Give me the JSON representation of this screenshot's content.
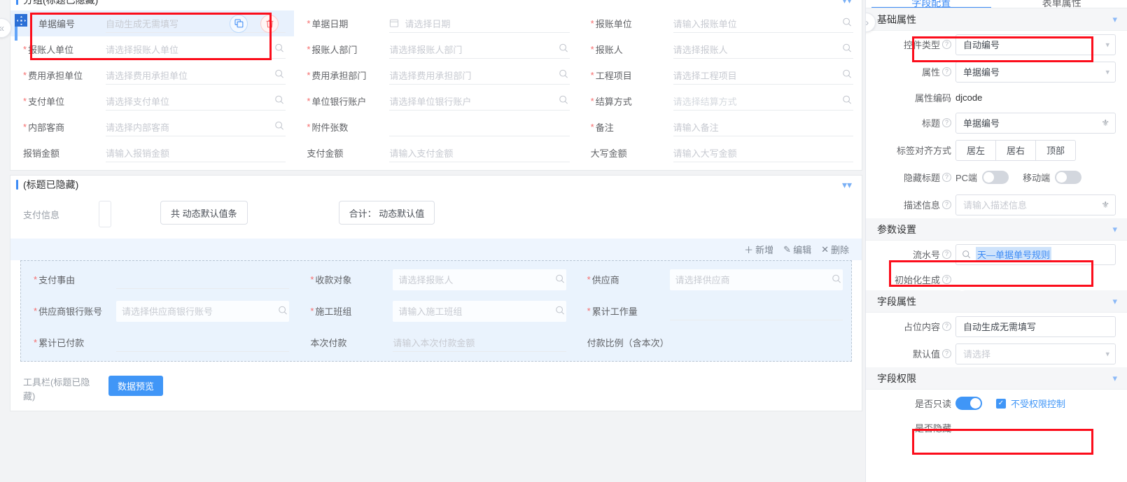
{
  "canvas": {
    "group1": {
      "title": "分组(标题已隐藏)",
      "fields": [
        {
          "label": "单据编号",
          "required": false,
          "placeholder": "自动生成无需填写",
          "icon": "",
          "selected": true
        },
        {
          "label": "单据日期",
          "required": true,
          "placeholder": "请选择日期",
          "icon": "calendar-icon"
        },
        {
          "label": "报账单位",
          "required": true,
          "placeholder": "请输入报账单位",
          "icon": "search-icon"
        },
        {
          "label": "报账人单位",
          "required": true,
          "placeholder": "请选择报账人单位",
          "icon": "search-icon"
        },
        {
          "label": "报账人部门",
          "required": true,
          "placeholder": "请选择报账人部门",
          "icon": "search-icon"
        },
        {
          "label": "报账人",
          "required": true,
          "placeholder": "请选择报账人",
          "icon": "search-icon"
        },
        {
          "label": "费用承担单位",
          "required": true,
          "placeholder": "请选择费用承担单位",
          "icon": "search-icon"
        },
        {
          "label": "费用承担部门",
          "required": true,
          "placeholder": "请选择费用承担部门",
          "icon": "search-icon"
        },
        {
          "label": "工程项目",
          "required": true,
          "placeholder": "请选择工程项目",
          "icon": "search-icon"
        },
        {
          "label": "支付单位",
          "required": true,
          "placeholder": "请选择支付单位",
          "icon": "search-icon"
        },
        {
          "label": "单位银行账户",
          "required": true,
          "placeholder": "请选择单位银行账户",
          "icon": "search-icon"
        },
        {
          "label": "结算方式",
          "required": true,
          "placeholder": "请选择结算方式",
          "icon": "search-icon"
        },
        {
          "label": "内部客商",
          "required": true,
          "placeholder": "请选择内部客商",
          "icon": "search-icon"
        },
        {
          "label": "附件张数",
          "required": true,
          "placeholder": "",
          "icon": ""
        },
        {
          "label": "备注",
          "required": true,
          "placeholder": "请输入备注",
          "icon": ""
        },
        {
          "label": "报销金额",
          "required": false,
          "placeholder": "请输入报销金额",
          "icon": ""
        },
        {
          "label": "支付金额",
          "required": false,
          "placeholder": "请输入支付金额",
          "icon": ""
        },
        {
          "label": "大写金额",
          "required": false,
          "placeholder": "请输入大写金额",
          "icon": ""
        }
      ],
      "row_actions": {
        "copy": "copy-icon",
        "delete": "delete-icon"
      }
    },
    "group2": {
      "title": "(标题已隐藏)",
      "pay_label": "支付信息",
      "count_pill": "共 动态默认值条",
      "total_pill": "合计： 动态默认值",
      "toolbar": [
        {
          "label": "新增",
          "icon": "plus-icon"
        },
        {
          "label": "编辑",
          "icon": "pencil-icon"
        },
        {
          "label": "删除",
          "icon": "close-icon"
        }
      ],
      "detail_fields": [
        {
          "label": "支付事由",
          "required": true,
          "placeholder": "",
          "icon": "",
          "boxed": false
        },
        {
          "label": "收款对象",
          "required": true,
          "placeholder": "请选择报账人",
          "icon": "search-icon",
          "boxed": true
        },
        {
          "label": "供应商",
          "required": true,
          "placeholder": "请选择供应商",
          "icon": "search-icon",
          "boxed": true
        },
        {
          "label": "供应商银行账号",
          "required": true,
          "placeholder": "请选择供应商银行账号",
          "icon": "search-icon",
          "boxed": true
        },
        {
          "label": "施工班组",
          "required": true,
          "placeholder": "请输入施工班组",
          "icon": "search-icon",
          "boxed": true
        },
        {
          "label": "累计工作量",
          "required": true,
          "placeholder": "",
          "icon": "",
          "boxed": false
        },
        {
          "label": "累计已付款",
          "required": true,
          "placeholder": "",
          "icon": "",
          "boxed": false
        },
        {
          "label": "本次付款",
          "required": false,
          "placeholder": "请输入本次付款金额",
          "icon": "",
          "boxed": false
        },
        {
          "label": "付款比例（含本次）",
          "required": false,
          "placeholder": "",
          "icon": "",
          "boxed": false
        }
      ],
      "bottom_toolbar_label": "工具栏(标题已隐藏)",
      "preview_button": "数据预览"
    }
  },
  "rightPanel": {
    "tabs": [
      {
        "label": "字段配置",
        "active": true
      },
      {
        "label": "表单属性",
        "active": false
      }
    ],
    "sections": [
      {
        "title": "基础属性",
        "rows": [
          {
            "type": "select",
            "label": "控件类型",
            "help": true,
            "value": "自动编号",
            "highlighted": true
          },
          {
            "type": "select",
            "label": "属性",
            "help": true,
            "value": "单据编号"
          },
          {
            "type": "text",
            "label": "属性编码",
            "help": false,
            "value": "djcode"
          },
          {
            "type": "select-globe",
            "label": "标题",
            "help": true,
            "value": "单据编号"
          },
          {
            "type": "segmented",
            "label": "标签对齐方式",
            "help": false,
            "options": [
              "居左",
              "居右",
              "顶部"
            ]
          },
          {
            "type": "dual-switch",
            "label": "隐藏标题",
            "help": true,
            "items": [
              {
                "name": "PC端",
                "on": false
              },
              {
                "name": "移动端",
                "on": false
              }
            ]
          },
          {
            "type": "select-globe",
            "label": "描述信息",
            "help": true,
            "value": "请输入描述信息",
            "placeholder": true
          }
        ]
      },
      {
        "title": "参数设置",
        "rows": [
          {
            "type": "search",
            "label": "流水号",
            "help": true,
            "value": "天—单据单号规则",
            "icon": "search-icon",
            "highlighted": true
          },
          {
            "type": "switch",
            "label": "初始化生成",
            "help": true,
            "on": false
          }
        ]
      },
      {
        "title": "字段属性",
        "rows": [
          {
            "type": "select-plain",
            "label": "占位内容",
            "help": true,
            "value": "自动生成无需填写"
          },
          {
            "type": "select",
            "label": "默认值",
            "help": true,
            "value": "请选择",
            "placeholder": true
          }
        ]
      },
      {
        "title": "字段权限",
        "rows": [
          {
            "type": "switch-check",
            "label": "是否只读",
            "help": false,
            "on": true,
            "checkbox": {
              "checked": true,
              "label": "不受权限控制"
            },
            "highlighted": true
          },
          {
            "type": "switch",
            "label": "是否隐藏",
            "help": false,
            "on": false
          }
        ]
      }
    ]
  },
  "colors": {
    "accent": "#4096f7",
    "annotation": "#fc0d1b",
    "required": "#f56c6c",
    "selectedRow": "#e8f1fd",
    "dashedPanel": "#eaf3fd"
  }
}
